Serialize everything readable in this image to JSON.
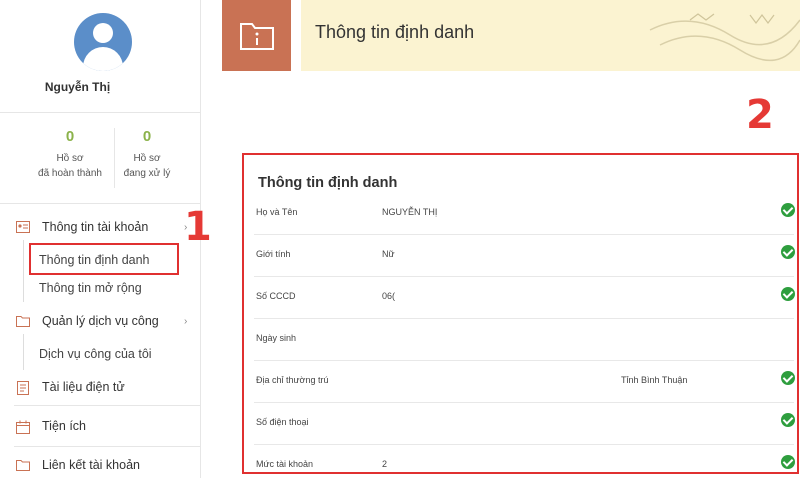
{
  "user": {
    "name": "Nguyễn Thị"
  },
  "stats": [
    {
      "value": "0",
      "label_line1": "Hồ sơ",
      "label_line2": "đã hoàn thành"
    },
    {
      "value": "0",
      "label_line1": "Hồ sơ",
      "label_line2": "đang xử lý"
    }
  ],
  "sidebar": {
    "account": "Thông tin tài khoản",
    "identity": "Thông tin định danh",
    "extended": "Thông tin mở rộng",
    "services": "Quản lý dịch vụ công",
    "my_services": "Dịch vụ công của tôi",
    "documents": "Tài liệu điện tử",
    "utilities": "Tiện ích",
    "link_account": "Liên kết tài khoản"
  },
  "markers": {
    "one": "1",
    "two": "2"
  },
  "header": {
    "title": "Thông tin định danh"
  },
  "panel": {
    "title": "Thông tin định danh",
    "rows": [
      {
        "key": "Họ và Tên",
        "value": "NGUYỄN THỊ",
        "value2": "",
        "verified": true
      },
      {
        "key": "Giới tính",
        "value": "Nữ",
        "value2": "",
        "verified": true
      },
      {
        "key": "Số CCCD",
        "value": "06(",
        "value2": "",
        "verified": true
      },
      {
        "key": "Ngày sinh",
        "value": "",
        "value2": "",
        "verified": false
      },
      {
        "key": "Địa chỉ thường trú",
        "value": "",
        "value2": "Tỉnh Bình Thuận",
        "verified": true
      },
      {
        "key": "Số điện thoại",
        "value": "",
        "value2": "",
        "verified": true
      },
      {
        "key": "Mức tài khoản",
        "value": "2",
        "value2": "",
        "verified": true
      }
    ]
  },
  "colors": {
    "accent": "#c97254",
    "stat": "#8bb24a",
    "highlight": "#e03030",
    "check": "#2e9e3e",
    "header_bg": "#fbf3d1"
  },
  "icons": [
    "user-avatar-icon",
    "id-card-icon",
    "folder-icon",
    "document-icon",
    "calendar-icon",
    "link-icon",
    "check-circle-icon"
  ]
}
